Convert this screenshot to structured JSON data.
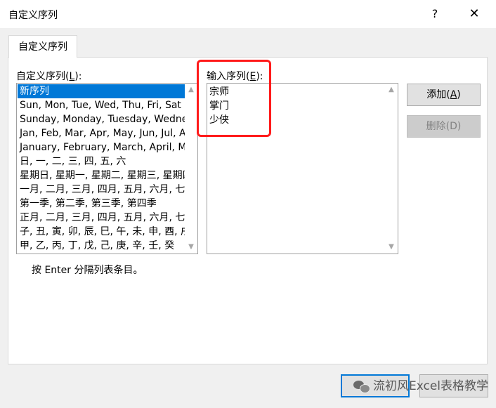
{
  "window": {
    "title": "自定义序列",
    "help_label": "?",
    "close_label": "✕"
  },
  "tab": {
    "label": "自定义序列"
  },
  "left_list": {
    "label_prefix": "自定义序列(",
    "label_key": "L",
    "label_suffix": "):",
    "items": [
      "新序列",
      "Sun, Mon, Tue, Wed, Thu, Fri, Sat",
      "Sunday, Monday, Tuesday, Wednesday",
      "Jan, Feb, Mar, Apr, May, Jun, Jul, Aug",
      "January, February, March, April, May",
      "日, 一, 二, 三, 四, 五, 六",
      "星期日, 星期一, 星期二, 星期三, 星期四",
      "一月, 二月, 三月, 四月, 五月, 六月, 七月",
      "第一季, 第二季, 第三季, 第四季",
      "正月, 二月, 三月, 四月, 五月, 六月, 七月",
      "子, 丑, 寅, 卯, 辰, 巳, 午, 未, 申, 酉, 戌",
      "甲, 乙, 丙, 丁, 戊, 己, 庚, 辛, 壬, 癸"
    ],
    "selected_index": 0
  },
  "entries": {
    "label_prefix": "输入序列(",
    "label_key": "E",
    "label_suffix": "):",
    "lines": [
      "宗师",
      "掌门",
      "少侠"
    ]
  },
  "buttons": {
    "add_prefix": "添加(",
    "add_key": "A",
    "add_suffix": ")",
    "delete_label": "删除(D)"
  },
  "hint": "按 Enter 分隔列表条目。",
  "watermark": {
    "text": "流初风Excel表格教学",
    "icon": "wechat-icon"
  },
  "colors": {
    "selection": "#0078d7",
    "highlight": "#ff1a1a"
  }
}
